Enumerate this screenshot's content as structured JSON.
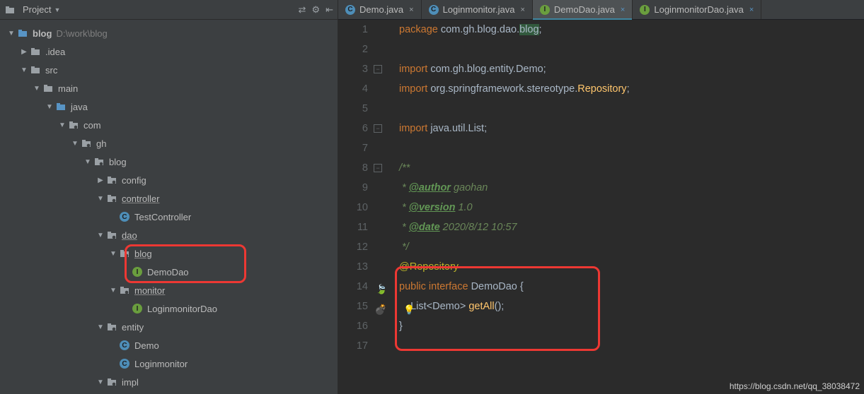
{
  "project_panel": {
    "title": "Project",
    "root": {
      "name": "blog",
      "path": "D:\\work\\blog"
    },
    "tree": [
      {
        "depth": 0,
        "arrow": "down",
        "icon": "folder-b",
        "name": "blog",
        "path": "D:\\work\\blog",
        "bold": true
      },
      {
        "depth": 1,
        "arrow": "right",
        "icon": "folder",
        "name": ".idea"
      },
      {
        "depth": 1,
        "arrow": "down",
        "icon": "folder",
        "name": "src"
      },
      {
        "depth": 2,
        "arrow": "down",
        "icon": "folder",
        "name": "main"
      },
      {
        "depth": 3,
        "arrow": "down",
        "icon": "folder-b",
        "name": "java"
      },
      {
        "depth": 4,
        "arrow": "down",
        "icon": "pkg",
        "name": "com"
      },
      {
        "depth": 5,
        "arrow": "down",
        "icon": "pkg",
        "name": "gh"
      },
      {
        "depth": 6,
        "arrow": "down",
        "icon": "pkg",
        "name": "blog"
      },
      {
        "depth": 7,
        "arrow": "right",
        "icon": "pkg",
        "name": "config"
      },
      {
        "depth": 7,
        "arrow": "down",
        "icon": "pkg",
        "name": "controller",
        "ul": true
      },
      {
        "depth": 8,
        "arrow": "",
        "icon": "cls-c",
        "name": "TestController"
      },
      {
        "depth": 7,
        "arrow": "down",
        "icon": "pkg",
        "name": "dao",
        "ul": true
      },
      {
        "depth": 8,
        "arrow": "down",
        "icon": "pkg",
        "name": "blog",
        "ul": true
      },
      {
        "depth": 9,
        "arrow": "",
        "icon": "cls-i",
        "name": "DemoDao"
      },
      {
        "depth": 8,
        "arrow": "down",
        "icon": "pkg",
        "name": "monitor",
        "ul": true
      },
      {
        "depth": 9,
        "arrow": "",
        "icon": "cls-i",
        "name": "LoginmonitorDao"
      },
      {
        "depth": 7,
        "arrow": "down",
        "icon": "pkg",
        "name": "entity"
      },
      {
        "depth": 8,
        "arrow": "",
        "icon": "cls-c",
        "name": "Demo"
      },
      {
        "depth": 8,
        "arrow": "",
        "icon": "cls-c",
        "name": "Loginmonitor"
      },
      {
        "depth": 7,
        "arrow": "down",
        "icon": "pkg",
        "name": "impl"
      }
    ],
    "toolbar": {
      "tooltips": [
        "toggle-flatten",
        "settings",
        "collapse-all"
      ]
    }
  },
  "tabs": [
    {
      "icon": "cls-c",
      "label": "Demo.java",
      "close": "x"
    },
    {
      "icon": "cls-c",
      "label": "Loginmonitor.java",
      "close": "x"
    },
    {
      "icon": "cls-i",
      "label": "DemoDao.java",
      "close": "dot",
      "active": true
    },
    {
      "icon": "cls-i",
      "label": "LoginmonitorDao.java",
      "close": "dot"
    }
  ],
  "code": {
    "lines": [
      "package com.gh.blog.dao.blog;",
      "",
      "import com.gh.blog.entity.Demo;",
      "import org.springframework.stereotype.Repository;",
      "",
      "import java.util.List;",
      "",
      "/**",
      " * @author gaohan",
      " * @version 1.0",
      " * @date 2020/8/12 10:57",
      " */",
      "@Repository",
      "public interface DemoDao {",
      "    List<Demo> getAll();",
      "}",
      ""
    ],
    "line_numbers": [
      "1",
      "2",
      "3",
      "4",
      "5",
      "6",
      "7",
      "8",
      "9",
      "10",
      "11",
      "12",
      "13",
      "14",
      "15",
      "16",
      "17"
    ]
  },
  "watermark": "https://blog.csdn.net/qq_38038472",
  "highlight_boxes": {
    "tree_box_lines": [
      12,
      13
    ],
    "code_box_lines": [
      13,
      16
    ]
  }
}
